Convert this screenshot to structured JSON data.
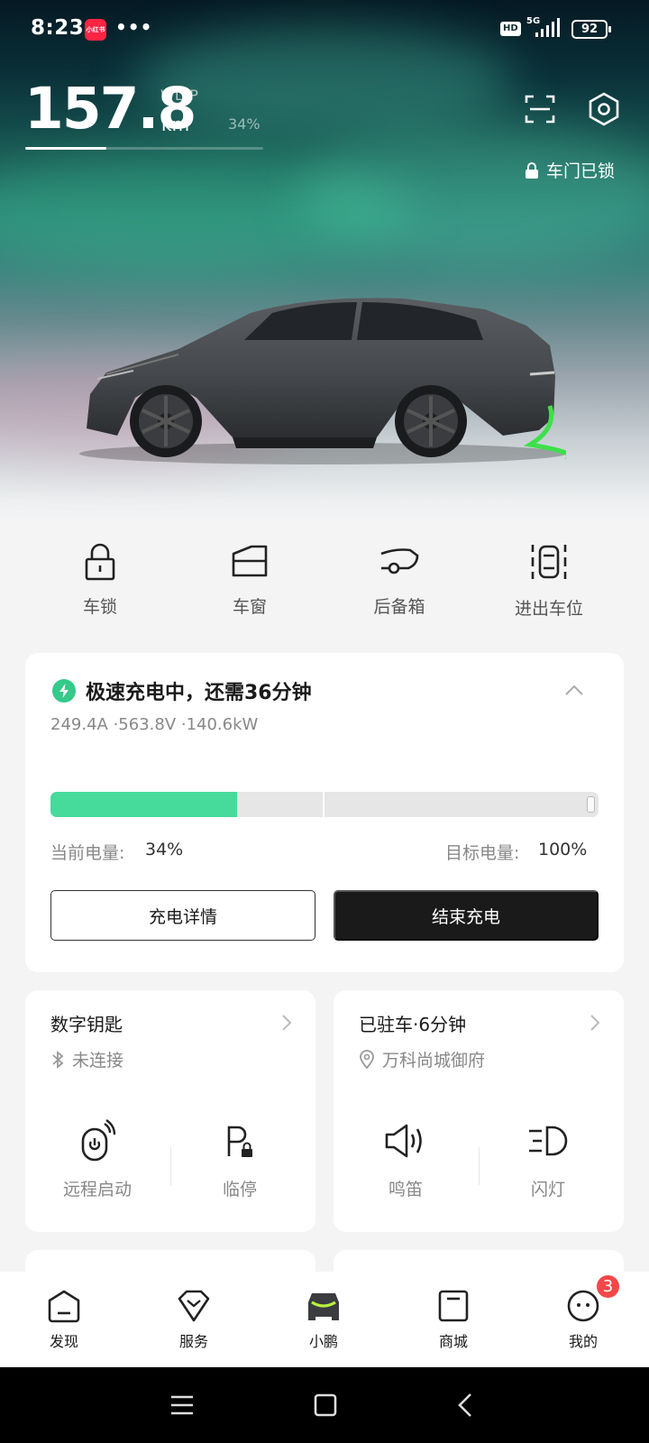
{
  "status_bar": {
    "time": "8:23",
    "app_icon_text": "小红书",
    "dots": "•••",
    "hd": "HD",
    "network": "5G",
    "battery": "92"
  },
  "hero": {
    "range_value": "157.8",
    "range_standard": "WLTP",
    "range_unit": "km",
    "battery_percent": "34%",
    "range_bar_fraction": 0.34,
    "lock_status": "车门已锁",
    "icons": [
      "scan-icon",
      "settings-icon"
    ]
  },
  "quick_actions": [
    {
      "label": "车锁",
      "icon": "lock-icon"
    },
    {
      "label": "车窗",
      "icon": "window-icon"
    },
    {
      "label": "后备箱",
      "icon": "trunk-icon"
    },
    {
      "label": "进出车位",
      "icon": "parking-icon"
    }
  ],
  "charging": {
    "title": "极速充电中，还需36分钟",
    "detail": "249.4A ·563.8V ·140.6kW",
    "current_label": "当前电量:",
    "current_value": "34%",
    "target_label": "目标电量:",
    "target_value": "100%",
    "progress_fraction": 0.34,
    "detail_button": "充电详情",
    "stop_button": "结束充电",
    "accent": "#46db9b"
  },
  "digital_key": {
    "title": "数字钥匙",
    "status": "未连接",
    "actions": [
      {
        "label": "远程启动",
        "icon": "remote-start-icon"
      },
      {
        "label": "临停",
        "icon": "temp-parking-icon"
      }
    ]
  },
  "parking": {
    "title": "已驻车·6分钟",
    "location": "万科尚城御府",
    "actions": [
      {
        "label": "鸣笛",
        "icon": "horn-icon"
      },
      {
        "label": "闪灯",
        "icon": "flash-lights-icon"
      }
    ]
  },
  "tab_bar": {
    "tabs": [
      {
        "label": "发现",
        "icon": "discover-icon"
      },
      {
        "label": "服务",
        "icon": "service-icon"
      },
      {
        "label": "小鹏",
        "icon": "car-icon",
        "active": true
      },
      {
        "label": "商城",
        "icon": "mall-icon"
      },
      {
        "label": "我的",
        "icon": "profile-icon"
      }
    ],
    "badge": "3",
    "badge_color": "#f24848"
  },
  "nav_bar": {
    "icons": [
      "menu-icon",
      "home-icon",
      "back-icon"
    ]
  }
}
